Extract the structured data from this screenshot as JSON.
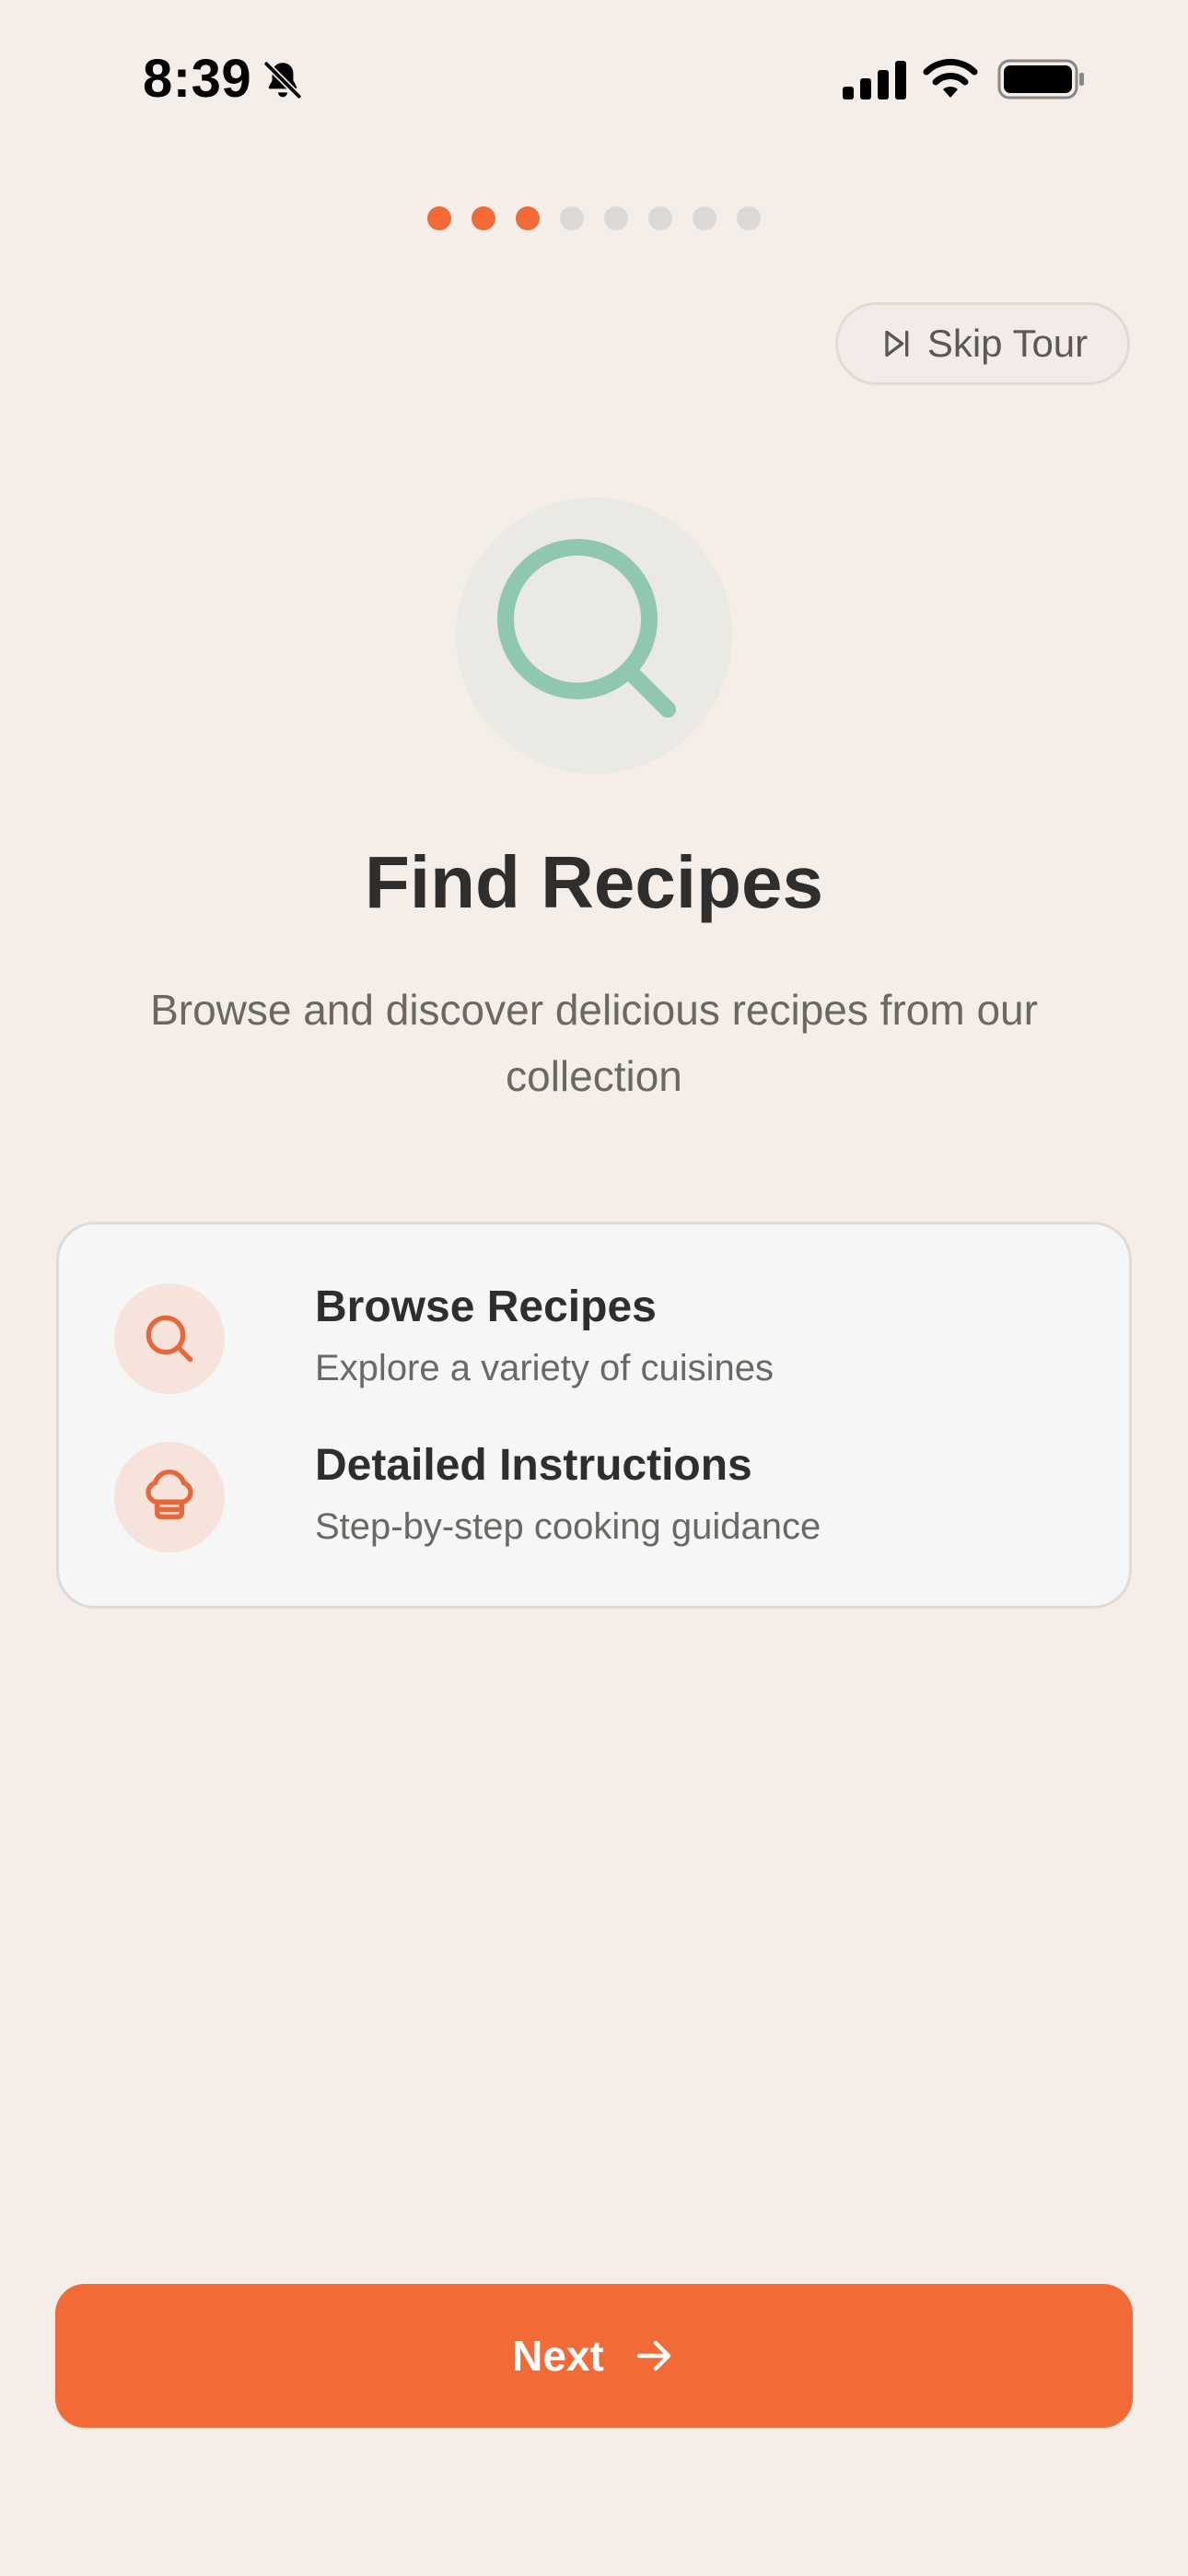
{
  "status_bar": {
    "time": "8:39",
    "icons": [
      "bell-slash-icon",
      "cellular-signal-icon",
      "wifi-icon",
      "battery-icon"
    ]
  },
  "pagination": {
    "total": 8,
    "active_count": 3,
    "active_color": "#F26A36",
    "inactive_color": "#DDD9D6"
  },
  "skip": {
    "label": "Skip Tour",
    "icon": "skip-forward-icon"
  },
  "hero": {
    "icon": "search-icon",
    "icon_color": "#8FC8AF",
    "title": "Find Recipes",
    "subtitle": "Browse and discover delicious recipes from our collection"
  },
  "features": [
    {
      "icon": "search-icon",
      "title": "Browse Recipes",
      "description": "Explore a variety of cuisines"
    },
    {
      "icon": "chef-hat-icon",
      "title": "Detailed Instructions",
      "description": "Step-by-step cooking guidance"
    }
  ],
  "next": {
    "label": "Next",
    "icon": "arrow-right-icon"
  },
  "colors": {
    "accent": "#F26A36",
    "background": "#F5EDE8",
    "hero_icon": "#8FC8AF"
  }
}
